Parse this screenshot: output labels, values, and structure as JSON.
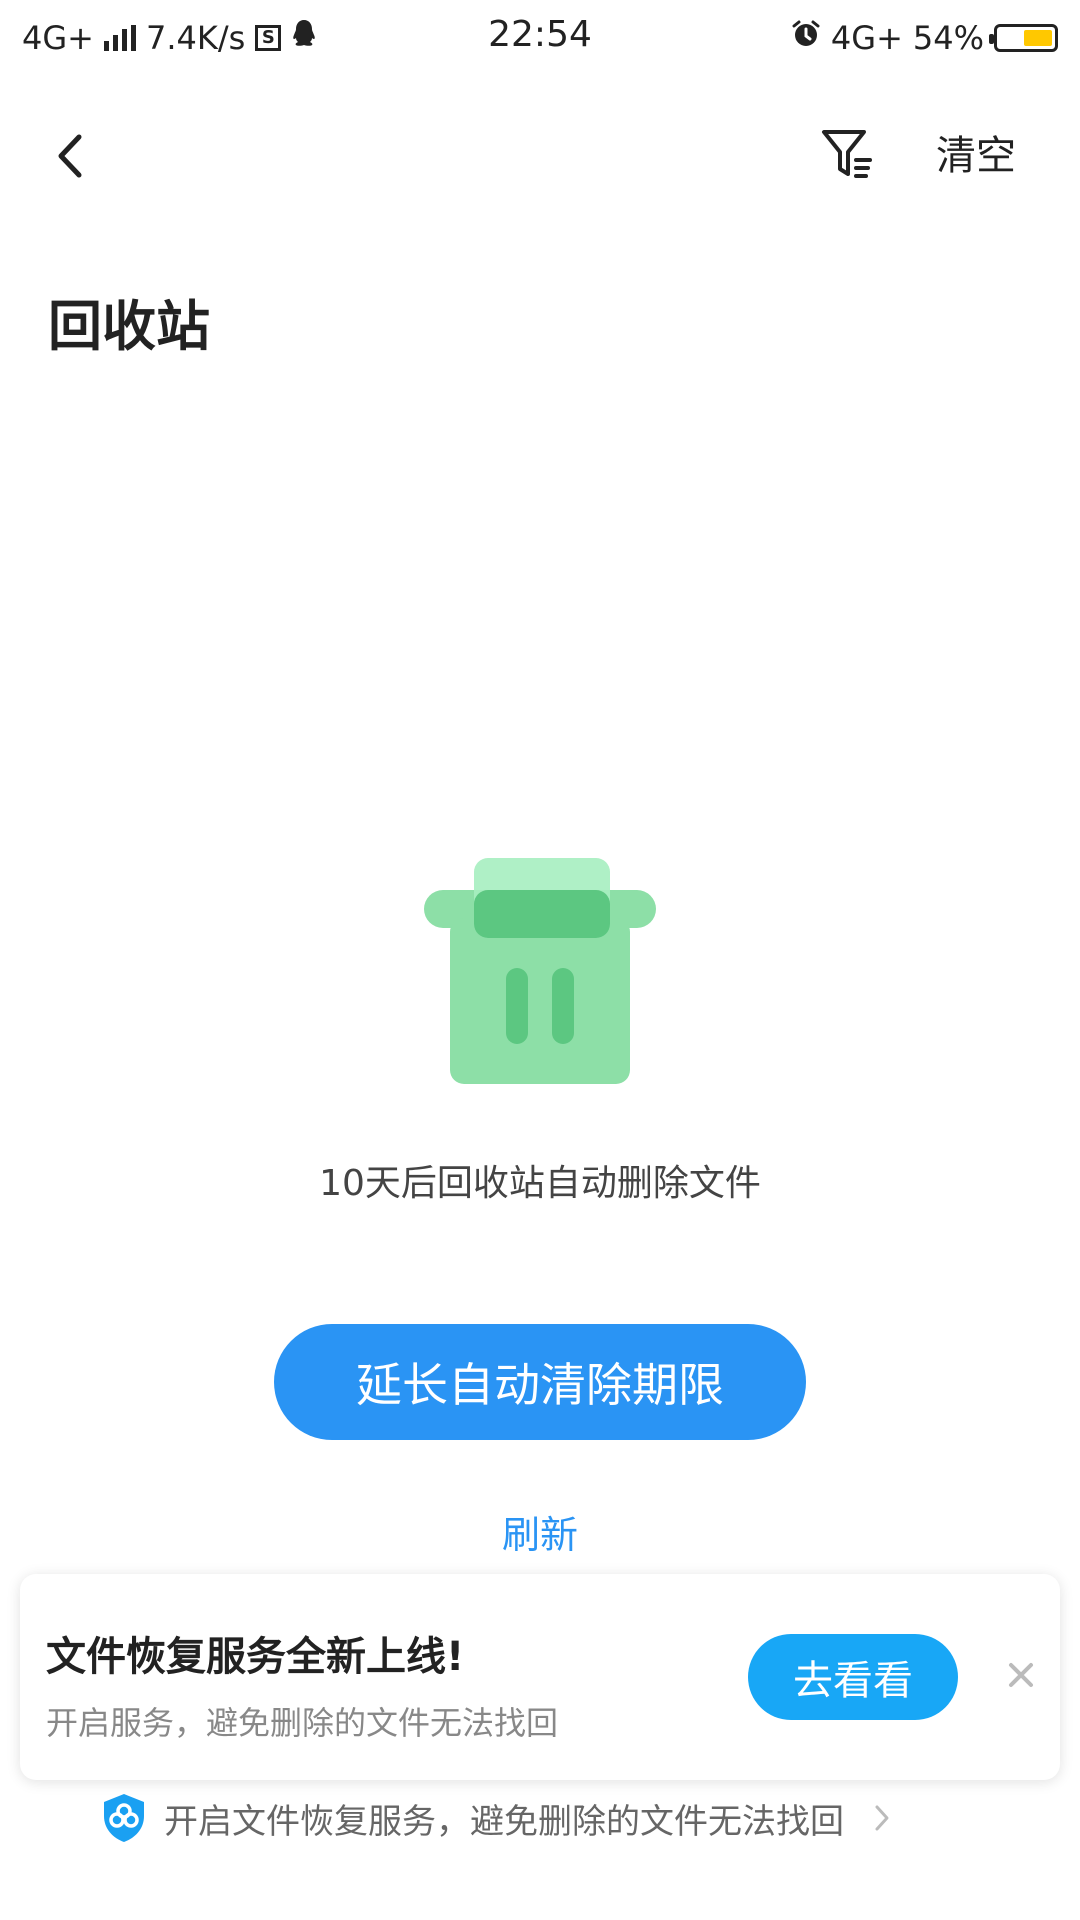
{
  "status_bar": {
    "network_left": "4G+",
    "speed": "7.4K/s",
    "s_badge": "S",
    "time": "22:54",
    "network_right": "4G+",
    "battery_percent": "54%",
    "battery_level": 0.54,
    "icons": [
      "signal-icon",
      "s-badge-icon",
      "qq-icon",
      "alarm-icon",
      "battery-icon"
    ]
  },
  "header": {
    "back_icon": "chevron-left-icon",
    "filter_icon": "filter-icon",
    "clear_label": "清空"
  },
  "page": {
    "title": "回收站"
  },
  "empty_state": {
    "illustration": "trash-bin-icon",
    "message": "10天后回收站自动删除文件",
    "extend_button": "延长自动清除期限",
    "refresh_link": "刷新"
  },
  "promo": {
    "title": "文件恢复服务全新上线!",
    "subtitle": "开启服务，避免删除的文件无法找回",
    "action_button": "去看看",
    "close_icon": "close-icon"
  },
  "footer": {
    "icon": "shield-icon",
    "text": "开启文件恢复服务，避免删除的文件无法找回",
    "chevron_icon": "chevron-right-icon"
  },
  "colors": {
    "accent_blue": "#2a94f4",
    "promo_button_blue": "#18a7f6",
    "trash_green": "#8ddfa7",
    "trash_green_dark": "#5cc781",
    "battery_yellow": "#ffc800"
  }
}
